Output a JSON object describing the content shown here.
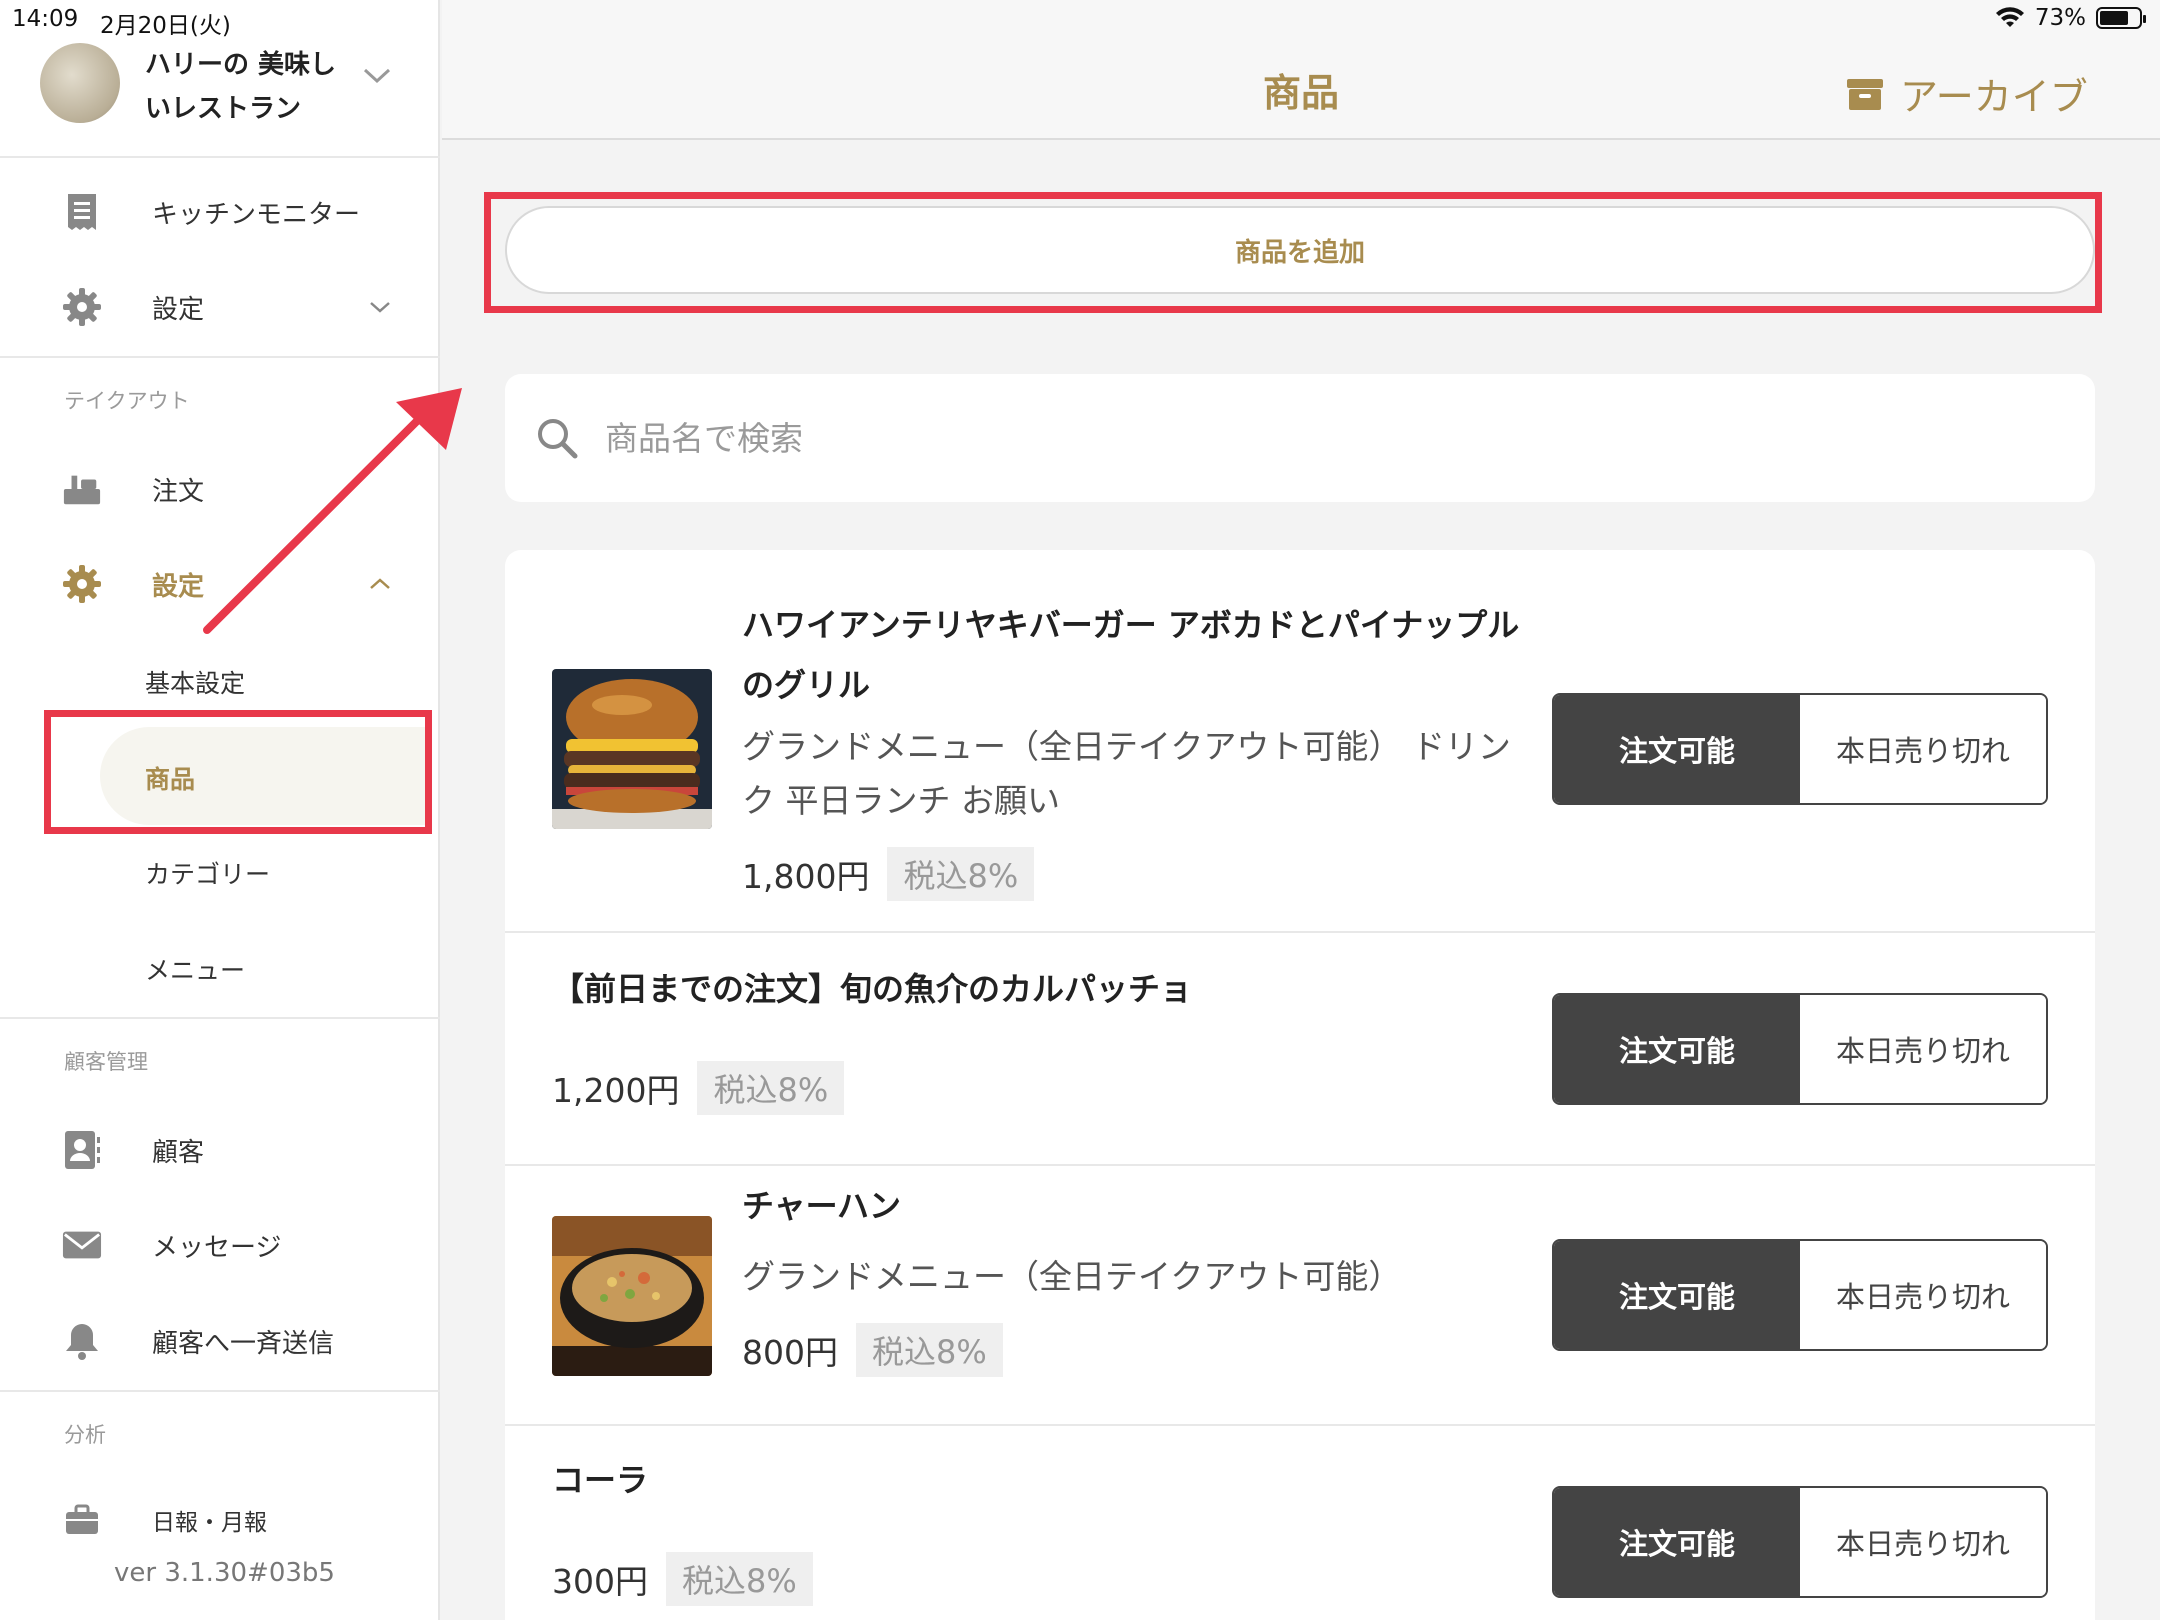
{
  "status_bar": {
    "time": "14:09",
    "date": "2月20日(火)",
    "battery": "73%",
    "battery_level": 0.73
  },
  "store": {
    "name": "ハリーの 美味しいレストラン"
  },
  "sidebar": {
    "top_items": [
      {
        "label": "キッチンモニター",
        "icon": "receipt-icon"
      },
      {
        "label": "設定",
        "icon": "gear-icon"
      }
    ],
    "takeout": {
      "section_label": "テイクアウト",
      "items": [
        {
          "label": "注文",
          "icon": "takeout-order-icon"
        },
        {
          "label": "設定",
          "icon": "gear-icon"
        }
      ],
      "sub_items": [
        "基本設定",
        "商品",
        "カテゴリー",
        "メニュー"
      ]
    },
    "customers": {
      "section_label": "顧客管理",
      "items": [
        {
          "label": "顧客",
          "icon": "contact-card-icon"
        },
        {
          "label": "メッセージ",
          "icon": "mail-icon"
        },
        {
          "label": "顧客へ一斉送信",
          "icon": "bell-icon"
        }
      ]
    },
    "analytics": {
      "section_label": "分析",
      "items": [
        {
          "label": "日報・月報",
          "icon": "briefcase-icon"
        }
      ]
    },
    "version": "ver 3.1.30#03b5"
  },
  "header": {
    "title": "商品",
    "archive_label": "アーカイブ"
  },
  "main": {
    "add_button": "商品を追加",
    "search_placeholder": "商品名で検索",
    "products": [
      {
        "name": "ハワイアンテリヤキバーガー アボカドとパイナップルのグリル",
        "category": "グランドメニュー（全日テイクアウト可能） ドリンク 平日ランチ お願い",
        "price": "1,800円",
        "tax": "税込8%",
        "has_image": true,
        "image": "burger"
      },
      {
        "name": "【前日までの注文】旬の魚介のカルパッチョ",
        "category": "",
        "price": "1,200円",
        "tax": "税込8%",
        "has_image": false
      },
      {
        "name": "チャーハン",
        "category": "グランドメニュー（全日テイクアウト可能）",
        "price": "800円",
        "tax": "税込8%",
        "has_image": true,
        "image": "fried-rice"
      },
      {
        "name": "コーラ",
        "category": "",
        "price": "300円",
        "tax": "税込8%",
        "has_image": false
      }
    ],
    "toggle": {
      "available": "注文可能",
      "sold_out": "本日売り切れ"
    }
  },
  "colors": {
    "accent": "#a88c4f",
    "highlight": "#e8384a",
    "dark": "#444444"
  }
}
